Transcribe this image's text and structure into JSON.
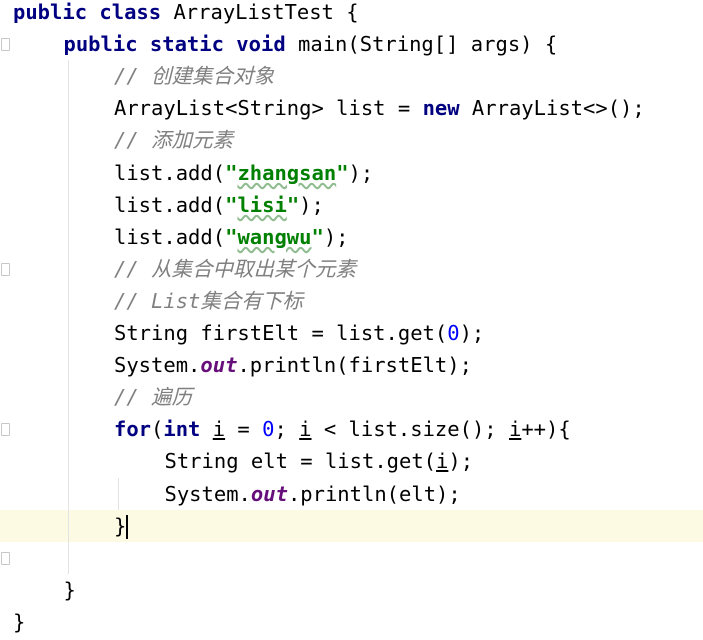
{
  "editor": {
    "lines": [
      {
        "indent": 0,
        "tokens": [
          {
            "t": "kw",
            "v": "public class"
          },
          {
            "t": "pl",
            "v": " ArrayListTest {"
          }
        ]
      },
      {
        "indent": 1,
        "tokens": [
          {
            "t": "kw",
            "v": "public static void"
          },
          {
            "t": "pl",
            "v": " main(String[] args) {"
          }
        ]
      },
      {
        "indent": 2,
        "tokens": [
          {
            "t": "cm",
            "v": "// 创建集合对象"
          }
        ]
      },
      {
        "indent": 2,
        "tokens": [
          {
            "t": "pl",
            "v": "ArrayList<String> list = "
          },
          {
            "t": "kw",
            "v": "new"
          },
          {
            "t": "pl",
            "v": " ArrayList<>();"
          }
        ]
      },
      {
        "indent": 2,
        "tokens": [
          {
            "t": "cm",
            "v": "// 添加元素"
          }
        ]
      },
      {
        "indent": 2,
        "tokens": [
          {
            "t": "pl",
            "v": "list.add("
          },
          {
            "t": "str",
            "v": "\"zhangsan\""
          },
          {
            "t": "pl",
            "v": ");"
          }
        ]
      },
      {
        "indent": 2,
        "tokens": [
          {
            "t": "pl",
            "v": "list.add("
          },
          {
            "t": "str",
            "v": "\"lisi\""
          },
          {
            "t": "pl",
            "v": ");"
          }
        ]
      },
      {
        "indent": 2,
        "tokens": [
          {
            "t": "pl",
            "v": "list.add("
          },
          {
            "t": "str",
            "v": "\"wangwu\""
          },
          {
            "t": "pl",
            "v": ");"
          }
        ]
      },
      {
        "indent": 2,
        "tokens": [
          {
            "t": "cm",
            "v": "// 从集合中取出某个元素"
          }
        ]
      },
      {
        "indent": 2,
        "tokens": [
          {
            "t": "cm",
            "v": "// List集合有下标"
          }
        ]
      },
      {
        "indent": 2,
        "tokens": [
          {
            "t": "pl",
            "v": "String firstElt = list.get("
          },
          {
            "t": "num",
            "v": "0"
          },
          {
            "t": "pl",
            "v": ");"
          }
        ]
      },
      {
        "indent": 2,
        "tokens": [
          {
            "t": "pl",
            "v": "System."
          },
          {
            "t": "st",
            "v": "out"
          },
          {
            "t": "pl",
            "v": ".println(firstElt);"
          }
        ]
      },
      {
        "indent": 2,
        "tokens": [
          {
            "t": "cm",
            "v": "// 遍历"
          }
        ]
      },
      {
        "indent": 2,
        "tokens": [
          {
            "t": "kw",
            "v": "for"
          },
          {
            "t": "pl",
            "v": "("
          },
          {
            "t": "kw",
            "v": "int"
          },
          {
            "t": "pl",
            "v": " "
          },
          {
            "t": "u",
            "v": "i"
          },
          {
            "t": "pl",
            "v": " = "
          },
          {
            "t": "num",
            "v": "0"
          },
          {
            "t": "pl",
            "v": "; "
          },
          {
            "t": "u",
            "v": "i"
          },
          {
            "t": "pl",
            "v": " < list.size(); "
          },
          {
            "t": "u",
            "v": "i"
          },
          {
            "t": "pl",
            "v": "++){"
          }
        ]
      },
      {
        "indent": 3,
        "tokens": [
          {
            "t": "pl",
            "v": "String elt = list.get("
          },
          {
            "t": "u",
            "v": "i"
          },
          {
            "t": "pl",
            "v": ");"
          }
        ]
      },
      {
        "indent": 3,
        "tokens": [
          {
            "t": "pl",
            "v": "System."
          },
          {
            "t": "st",
            "v": "out"
          },
          {
            "t": "pl",
            "v": ".println(elt);"
          }
        ]
      },
      {
        "indent": 2,
        "tokens": [
          {
            "t": "pl",
            "v": "}"
          }
        ]
      },
      {
        "indent": 0,
        "tokens": []
      },
      {
        "indent": 1,
        "tokens": [
          {
            "t": "pl",
            "v": "}"
          }
        ]
      },
      {
        "indent": 0,
        "tokens": [
          {
            "t": "pl",
            "v": "}"
          }
        ]
      }
    ],
    "current_line": 16,
    "caret_line": 16,
    "typo_words": [
      "zhangsan",
      "lisi",
      "wangwu"
    ],
    "colors": {
      "keyword": "#000080",
      "comment": "#808080",
      "string": "#008000",
      "number": "#0000ff",
      "static_field": "#660e7a",
      "current_line_bg": "#fcfae3"
    }
  }
}
